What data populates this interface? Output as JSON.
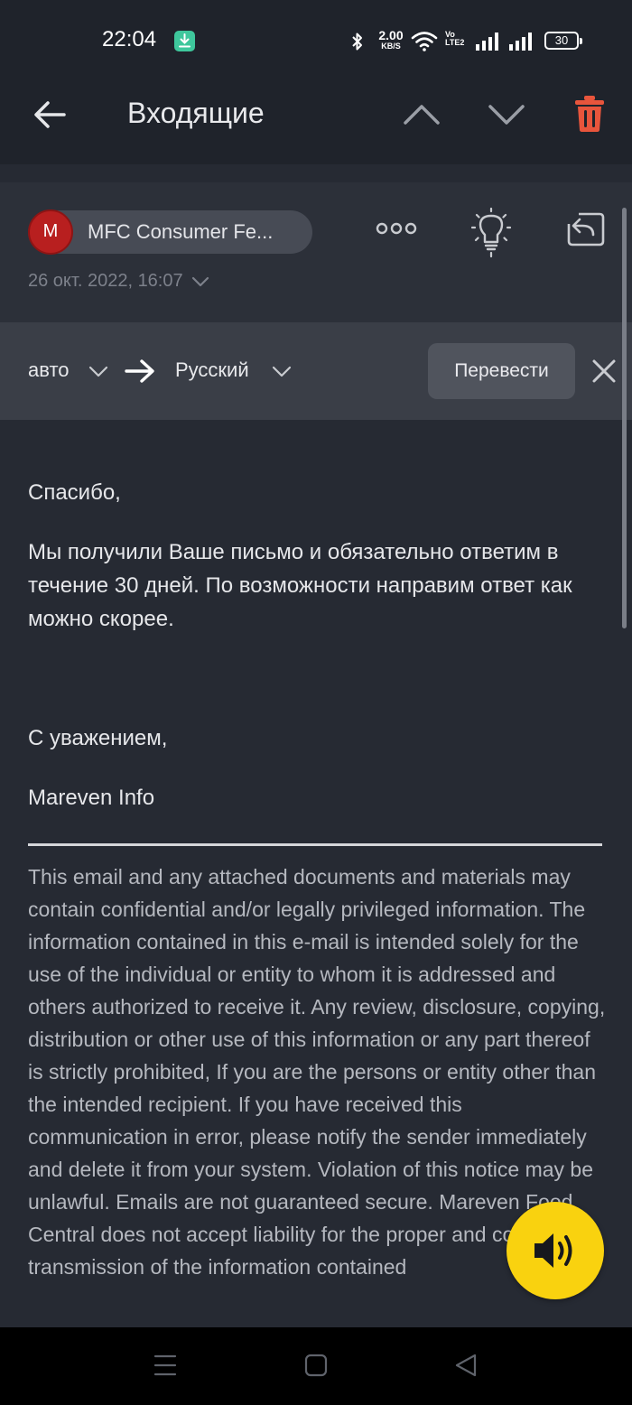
{
  "status_bar": {
    "time": "22:04",
    "download_icon": "download-icon",
    "net_speed_value": "2.00",
    "net_speed_unit": "KB/S",
    "volte_top": "Vo",
    "volte_bottom": "LTE2",
    "battery": "30"
  },
  "app_bar": {
    "title": "Входящие",
    "back_icon": "arrow-left-icon",
    "prev_icon": "chevron-up-icon",
    "next_icon": "chevron-down-icon",
    "delete_icon": "trash-icon"
  },
  "message": {
    "sender_initial": "M",
    "sender_name": "MFC Consumer Fe...",
    "date": "26 окт. 2022, 16:07",
    "actions": [
      "more-icon",
      "lightbulb-icon",
      "reply-icon"
    ]
  },
  "translate_bar": {
    "source_lang": "авто",
    "target_lang": "Русский",
    "translate_button": "Перевести"
  },
  "body": {
    "greeting": "Спасибо,",
    "main_text": "Мы получили Ваше письмо и обязательно ответим в течение 30 дней. По возможности направим ответ как можно скорее.",
    "closing": "С уважением,",
    "signature": "Mareven Info",
    "disclaimer": "This email and any attached documents and materials may contain confidential and/or legally privileged information. The information contained in this e-mail is intended solely for the use of the individual or entity to whom it is addressed and others authorized to receive it. Any review, disclosure, copying, distribution or other use of this information or any part thereof is strictly prohibited, If you are the persons or entity other than the intended recipient. If you have received this communication in error, please notify the sender immediately and delete it from your system. Violation of this notice may be unlawful. Emails are not guaranteed secure. Mareven Food Central does not accept liability for the proper and complete transmission of the information contained"
  },
  "fab": {
    "icon": "speaker-icon"
  },
  "nav_bar": {
    "icons": [
      "menu-icon",
      "home-square-icon",
      "back-triangle-icon"
    ]
  },
  "colors": {
    "accent_yellow": "#f9d20f",
    "delete_red": "#e8553c",
    "avatar_red": "#b81f1f",
    "background": "#262a33"
  }
}
